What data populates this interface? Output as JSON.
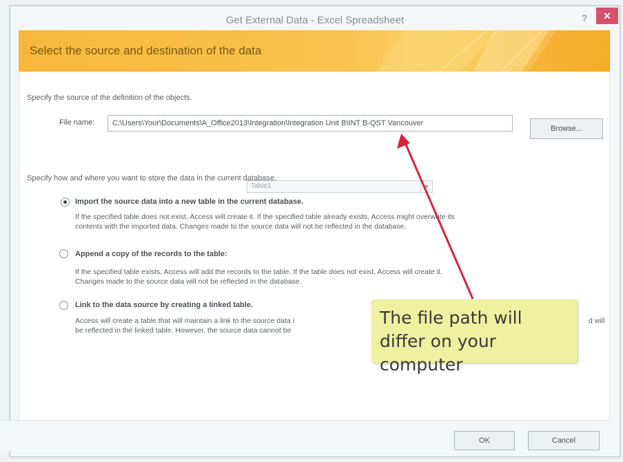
{
  "window": {
    "title": "Get External Data - Excel Spreadsheet",
    "help_label": "?",
    "close_label": "✕"
  },
  "banner": {
    "heading": "Select the source and destination of the data"
  },
  "source": {
    "intro": "Specify the source of the definition of the objects.",
    "file_label": "File name:",
    "file_value": "C:\\Users\\Your\\Documents\\A_Office2013\\Integration\\Integration Unit B\\INT B-QST Vancouver",
    "browse_label": "Browse..."
  },
  "storage": {
    "intro": "Specify how and where you want to store the data in the current database.",
    "options": [
      {
        "label": "Import the source data into a new table in the current database.",
        "description_line1": "If the specified table does not exist, Access will create it. If the specified table already exists, Access might overwrite its",
        "description_line2": "contents with the imported data. Changes made to the source data will not be reflected in the database.",
        "selected": true
      },
      {
        "label": "Append a copy of the records to the table:",
        "table_value": "Table1",
        "description_line1": "If the specified table exists, Access will add the records to the table. If the table does not exist, Access will create it.",
        "description_line2": "Changes made to the source data will not be reflected in the database.",
        "selected": false
      },
      {
        "label": "Link to the data source by creating a linked table.",
        "description_line1": "Access will create a table that will maintain a link to the source data i",
        "description_line1_tail": "d will",
        "description_line2": "be reflected in the linked table. However, the source data cannot be",
        "selected": false
      }
    ]
  },
  "footer": {
    "ok_label": "OK",
    "cancel_label": "Cancel"
  },
  "callout": {
    "text": "The file path will differ on your computer"
  },
  "colors": {
    "banner": "#f7b73c",
    "close_button": "#d6506e",
    "callout": "#eef1a0",
    "arrow": "#d8243a"
  }
}
